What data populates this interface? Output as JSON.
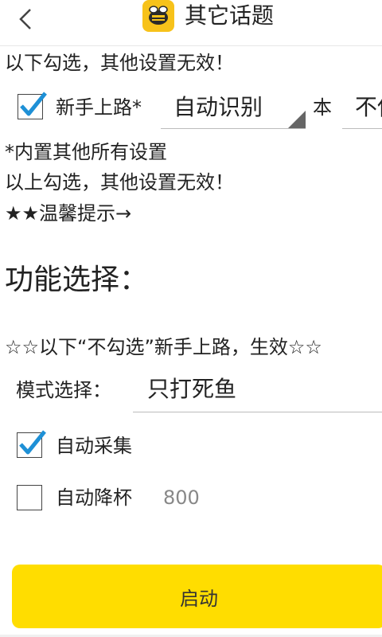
{
  "header": {
    "title": "其它话题",
    "back_icon": "chevron-left-icon",
    "logo_icon": "bee-icon"
  },
  "top_notice": "以下勾选，其他设置无效！",
  "novice": {
    "checked": true,
    "label": "新手上路*",
    "dropdown_value": "自动识别",
    "after_text": "本",
    "cut_field_value": "不使"
  },
  "notes": {
    "line1": "*内置其他所有设置",
    "line2": "以上勾选，其他设置无效！",
    "line3": "★★温馨提示→"
  },
  "section_title": "功能选择：",
  "hint": "☆☆以下“不勾选”新手上路，生效☆☆",
  "mode": {
    "label": "模式选择：",
    "value": "只打死鱼"
  },
  "options": [
    {
      "label": "自动采集",
      "checked": true
    },
    {
      "label": "自动降杯",
      "checked": false,
      "value": "800"
    }
  ],
  "start_button": "启动",
  "colors": {
    "accent": "#ffdd00",
    "checkmark": "#1e90d6",
    "logo": "#f7c21a"
  }
}
